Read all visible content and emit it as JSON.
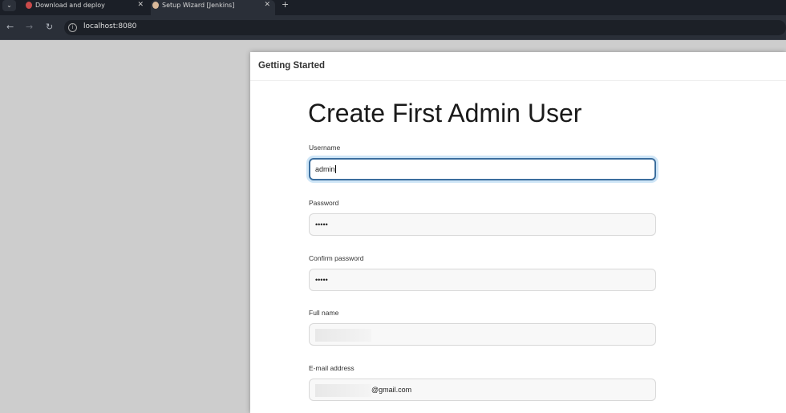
{
  "browser": {
    "tabs": [
      {
        "title": "Download and deploy",
        "active": false
      },
      {
        "title": "Setup Wizard [Jenkins]",
        "active": true
      }
    ],
    "url": "localhost:8080"
  },
  "dialog": {
    "header": "Getting Started",
    "title": "Create First Admin User",
    "fields": [
      {
        "label": "Username",
        "value": "admin"
      },
      {
        "label": "Password",
        "value": "•••••"
      },
      {
        "label": "Confirm password",
        "value": "•••••"
      },
      {
        "label": "Full name",
        "value": ""
      },
      {
        "label": "E-mail address",
        "value": "@gmail.com"
      }
    ]
  }
}
